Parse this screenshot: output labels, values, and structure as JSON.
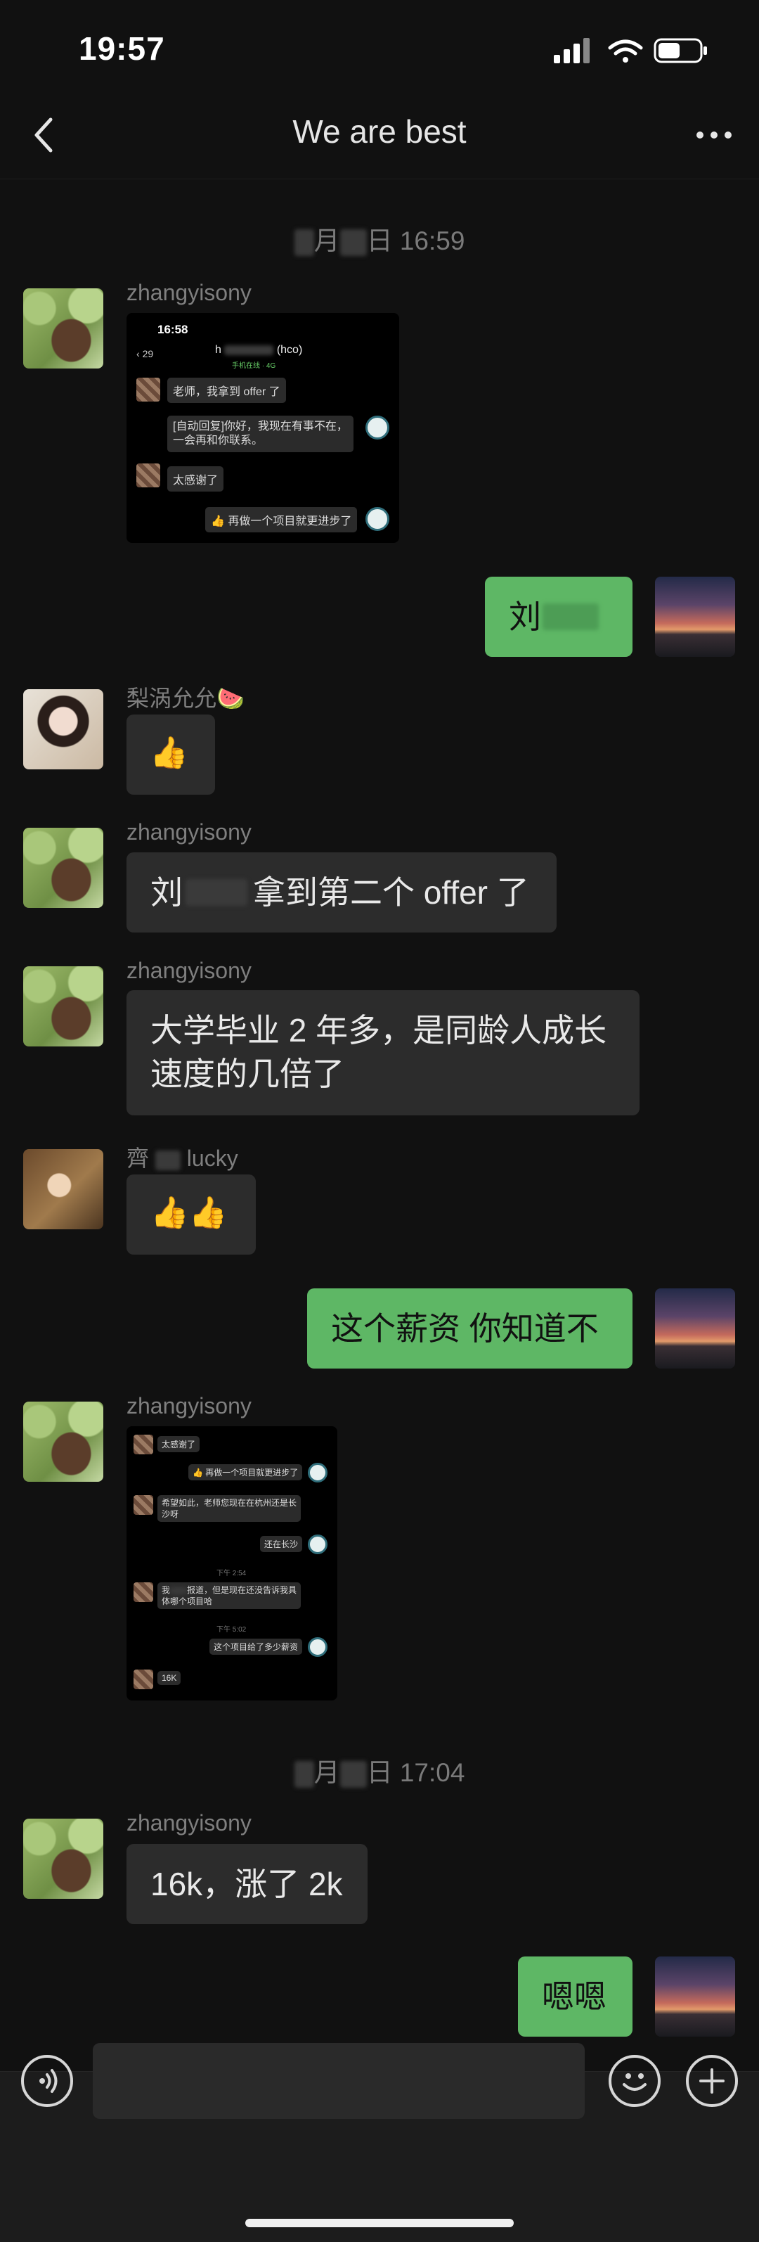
{
  "status_bar": {
    "time": "19:57"
  },
  "nav": {
    "title": "We are best"
  },
  "timestamps": [
    "月 日 16:59",
    "月 日 17:04"
  ],
  "messages": [
    {
      "sender": "zhangyisony",
      "type": "image"
    },
    {
      "sender": "me",
      "text": "刘"
    },
    {
      "sender": "梨涡允允🍉",
      "text": "👍"
    },
    {
      "sender": "zhangyisony",
      "text_prefix": "刘",
      "text_suffix": "拿到第二个 offer 了"
    },
    {
      "sender": "zhangyisony",
      "line1": "大学毕业 2 年多，是同龄人成长",
      "line2": "速度的几倍了"
    },
    {
      "sender": "齊",
      "sender_suffix": "lucky",
      "text": "👍👍"
    },
    {
      "sender": "me",
      "text": "这个薪资 你知道不"
    },
    {
      "sender": "zhangyisony",
      "type": "image"
    },
    {
      "sender": "zhangyisony",
      "text": "16k，涨了 2k"
    },
    {
      "sender": "me",
      "text": "嗯嗯"
    }
  ],
  "shot1": {
    "time": "16:58",
    "badge": "29",
    "name_prefix": "h",
    "name_suffix": "(hco)",
    "subtitle": "手机在线 · 4G",
    "rows": [
      "老师，我拿到 offer 了",
      "[自动回复]你好，我现在有事不在，",
      "一会再和你联系。",
      "太感谢了",
      "👍 再做一个项目就更进步了"
    ]
  },
  "shot2": {
    "rows": [
      "太感谢了",
      "👍 再做一个项目就更进步了",
      "希望如此，老师您现在在杭州还是长",
      "沙呀",
      "还在长沙",
      "下午 2:54",
      "我",
      "报道，但是现在还没告诉我具",
      "体哪个项目哈",
      "下午 5:02",
      "这个项目给了多少薪资",
      "16K"
    ]
  },
  "icons": {
    "back": "chevron-left-icon",
    "more": "more-dots-icon",
    "voice": "voice-icon",
    "emoji": "emoji-icon",
    "plus": "plus-icon"
  },
  "colors": {
    "background": "#111111",
    "bubble_other": "#2c2c2c",
    "bubble_me": "#5eb765"
  }
}
